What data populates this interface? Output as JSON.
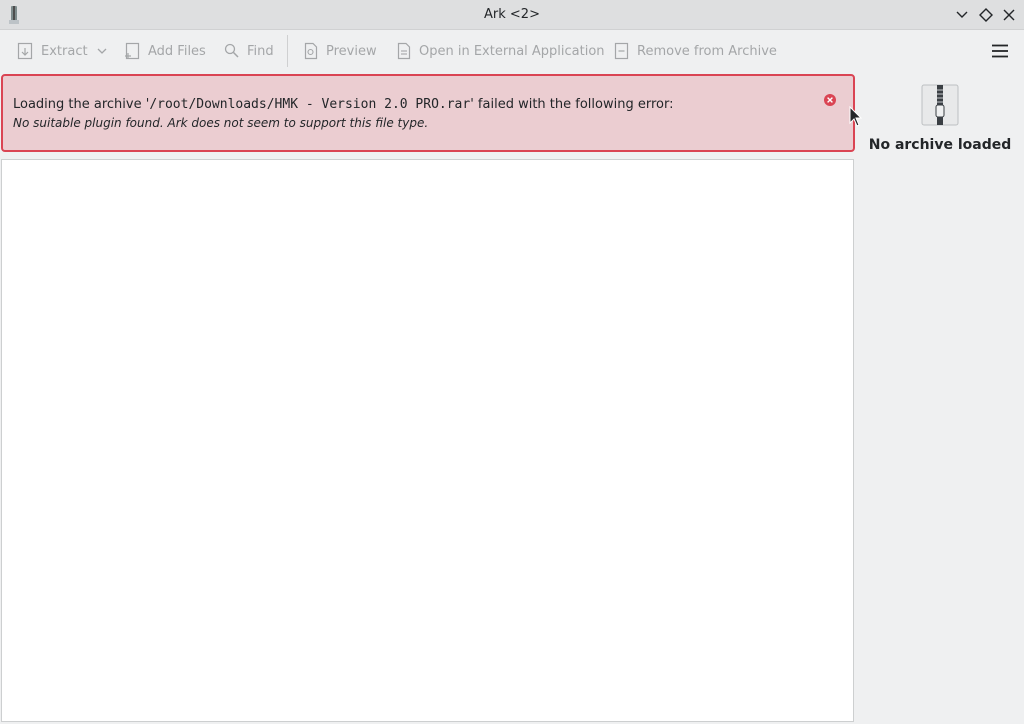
{
  "window": {
    "title": "Ark <2>"
  },
  "toolbar": {
    "extract_label": "Extract",
    "add_files_label": "Add Files",
    "find_label": "Find",
    "preview_label": "Preview",
    "open_external_label": "Open in External Application",
    "remove_label": "Remove from Archive"
  },
  "error": {
    "prefix": "Loading the archive '",
    "path": "/root/Downloads/HMK - Version 2.0 PRO.rar",
    "suffix": "' failed with the following error:",
    "detail": "No suitable plugin found. Ark does not seem to support this file type."
  },
  "side_panel": {
    "status": "No archive loaded"
  },
  "colors": {
    "error_border": "#da4453",
    "error_background": "#ebcdd1",
    "disabled_text": "#a4a6a8"
  },
  "icons": {
    "app": "ark-icon",
    "minimize": "chevron-down-icon",
    "maximize": "diamond-icon",
    "close": "close-icon",
    "extract": "extract-icon",
    "extract_menu": "chevron-down-icon",
    "add_files": "add-files-icon",
    "find": "search-icon",
    "preview": "preview-icon",
    "open_external": "document-open-icon",
    "remove": "remove-icon",
    "menu": "hamburger-menu-icon",
    "error_close": "close-circle-icon",
    "archive": "zip-archive-icon"
  }
}
